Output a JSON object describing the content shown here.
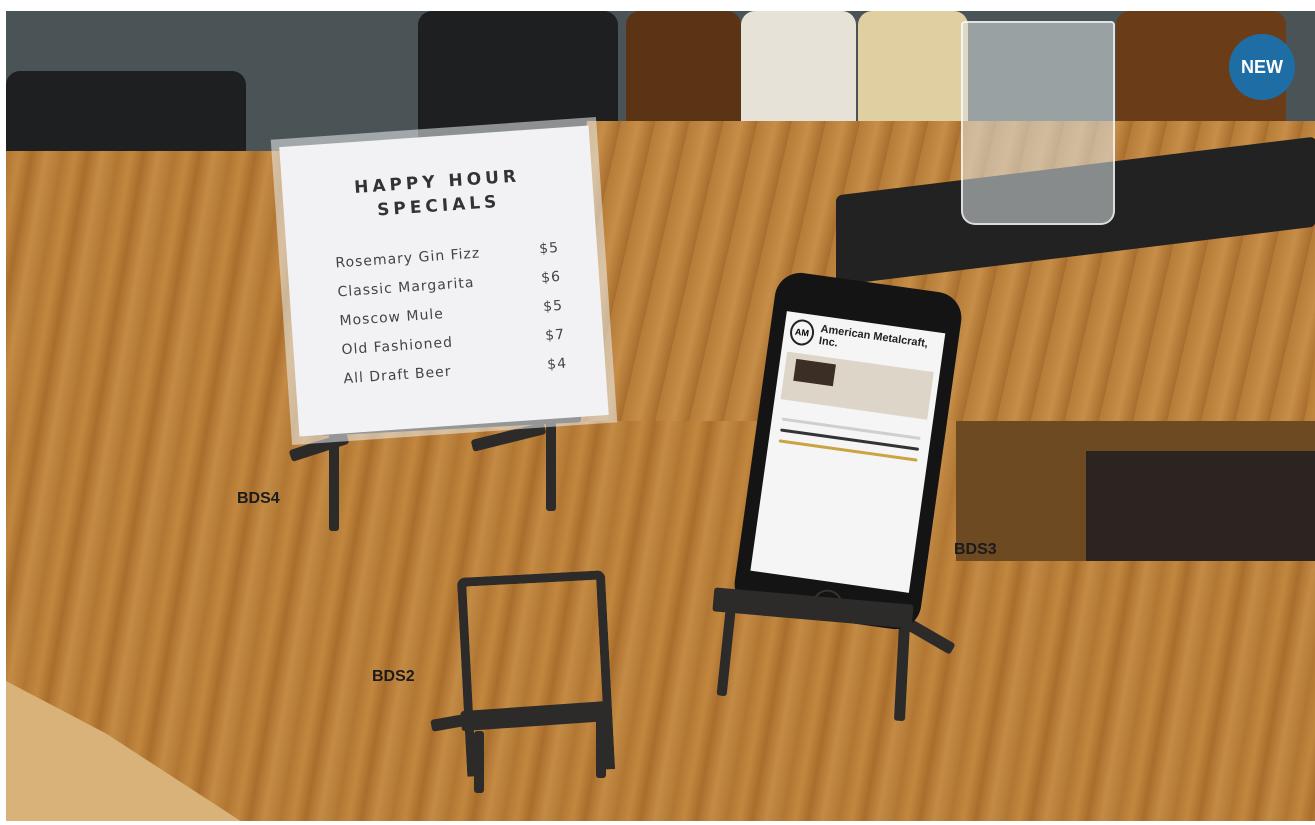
{
  "badge": {
    "text": "NEW",
    "color": "#1e6ea5"
  },
  "menu_card": {
    "title": "HAPPY HOUR\nSPECIALS",
    "items": [
      {
        "name": "Rosemary Gin Fizz",
        "price": "$5"
      },
      {
        "name": "Classic Margarita",
        "price": "$6"
      },
      {
        "name": "Moscow Mule",
        "price": "$5"
      },
      {
        "name": "Old Fashioned",
        "price": "$7"
      },
      {
        "name": "All Draft Beer",
        "price": "$4"
      }
    ]
  },
  "phone_screen": {
    "logo_mark": "AM",
    "brand": "American Metalcraft, Inc."
  },
  "labels": {
    "bds4": "BDS4",
    "bds3": "BDS3",
    "bds2": "BDS2"
  }
}
